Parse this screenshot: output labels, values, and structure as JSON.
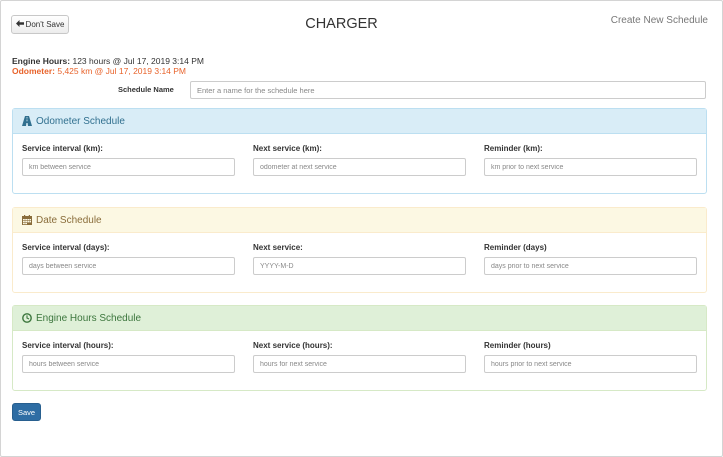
{
  "header": {
    "back_label": "Don't Save",
    "title": "CHARGER",
    "create_link": "Create New Schedule"
  },
  "info": {
    "engine_hours_label": "Engine Hours:",
    "engine_hours_value": "123 hours @ Jul 17, 2019 3:14 PM",
    "odometer_label": "Odometer:",
    "odometer_value": "5,425 km @ Jul 17, 2019 3:14 PM"
  },
  "schedule_name": {
    "label": "Schedule Name",
    "placeholder": "Enter a name for the schedule here",
    "value": ""
  },
  "panels": {
    "odometer": {
      "title": "Odometer Schedule",
      "icon": "road-icon",
      "color": "#31708f",
      "fields": [
        {
          "label": "Service interval (km):",
          "placeholder": "km between service"
        },
        {
          "label": "Next service (km):",
          "placeholder": "odometer at next service"
        },
        {
          "label": "Reminder (km):",
          "placeholder": "km prior to next service"
        }
      ]
    },
    "date": {
      "title": "Date Schedule",
      "icon": "calendar-icon",
      "color": "#8a6d3b",
      "fields": [
        {
          "label": "Service interval (days):",
          "placeholder": "days between service"
        },
        {
          "label": "Next service:",
          "placeholder": "YYYY-M-D"
        },
        {
          "label": "Reminder (days)",
          "placeholder": "days prior to next service"
        }
      ]
    },
    "engine": {
      "title": "Engine Hours Schedule",
      "icon": "clock-icon",
      "color": "#3c763d",
      "fields": [
        {
          "label": "Service interval (hours):",
          "placeholder": "hours between service"
        },
        {
          "label": "Next service (hours):",
          "placeholder": "hours for next service"
        },
        {
          "label": "Reminder (hours)",
          "placeholder": "hours prior to next service"
        }
      ]
    }
  },
  "footer": {
    "save_label": "Save",
    "save_color": "#2e6da4"
  }
}
